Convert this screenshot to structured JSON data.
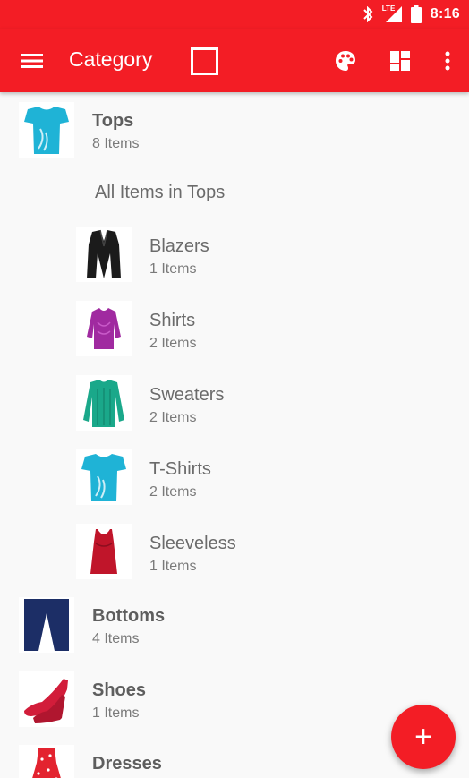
{
  "status_bar": {
    "network_label": "LTE",
    "time": "8:16"
  },
  "app_bar": {
    "title": "Category"
  },
  "categories": [
    {
      "name": "Tops",
      "count": "8 Items"
    },
    {
      "name": "Bottoms",
      "count": "4 Items"
    },
    {
      "name": "Shoes",
      "count": "1 Items"
    },
    {
      "name": "Dresses",
      "count": ""
    }
  ],
  "tops_section": {
    "all_items_label": "All Items in Tops",
    "subcategories": [
      {
        "name": "Blazers",
        "count": "1 Items"
      },
      {
        "name": "Shirts",
        "count": "2 Items"
      },
      {
        "name": "Sweaters",
        "count": "2 Items"
      },
      {
        "name": "T-Shirts",
        "count": "2 Items"
      },
      {
        "name": "Sleeveless",
        "count": "1 Items"
      }
    ]
  },
  "fab": {
    "label": "+"
  },
  "colors": {
    "primary": "#f31d25",
    "text": "#6b6b6b",
    "background": "#f9f9f9"
  }
}
